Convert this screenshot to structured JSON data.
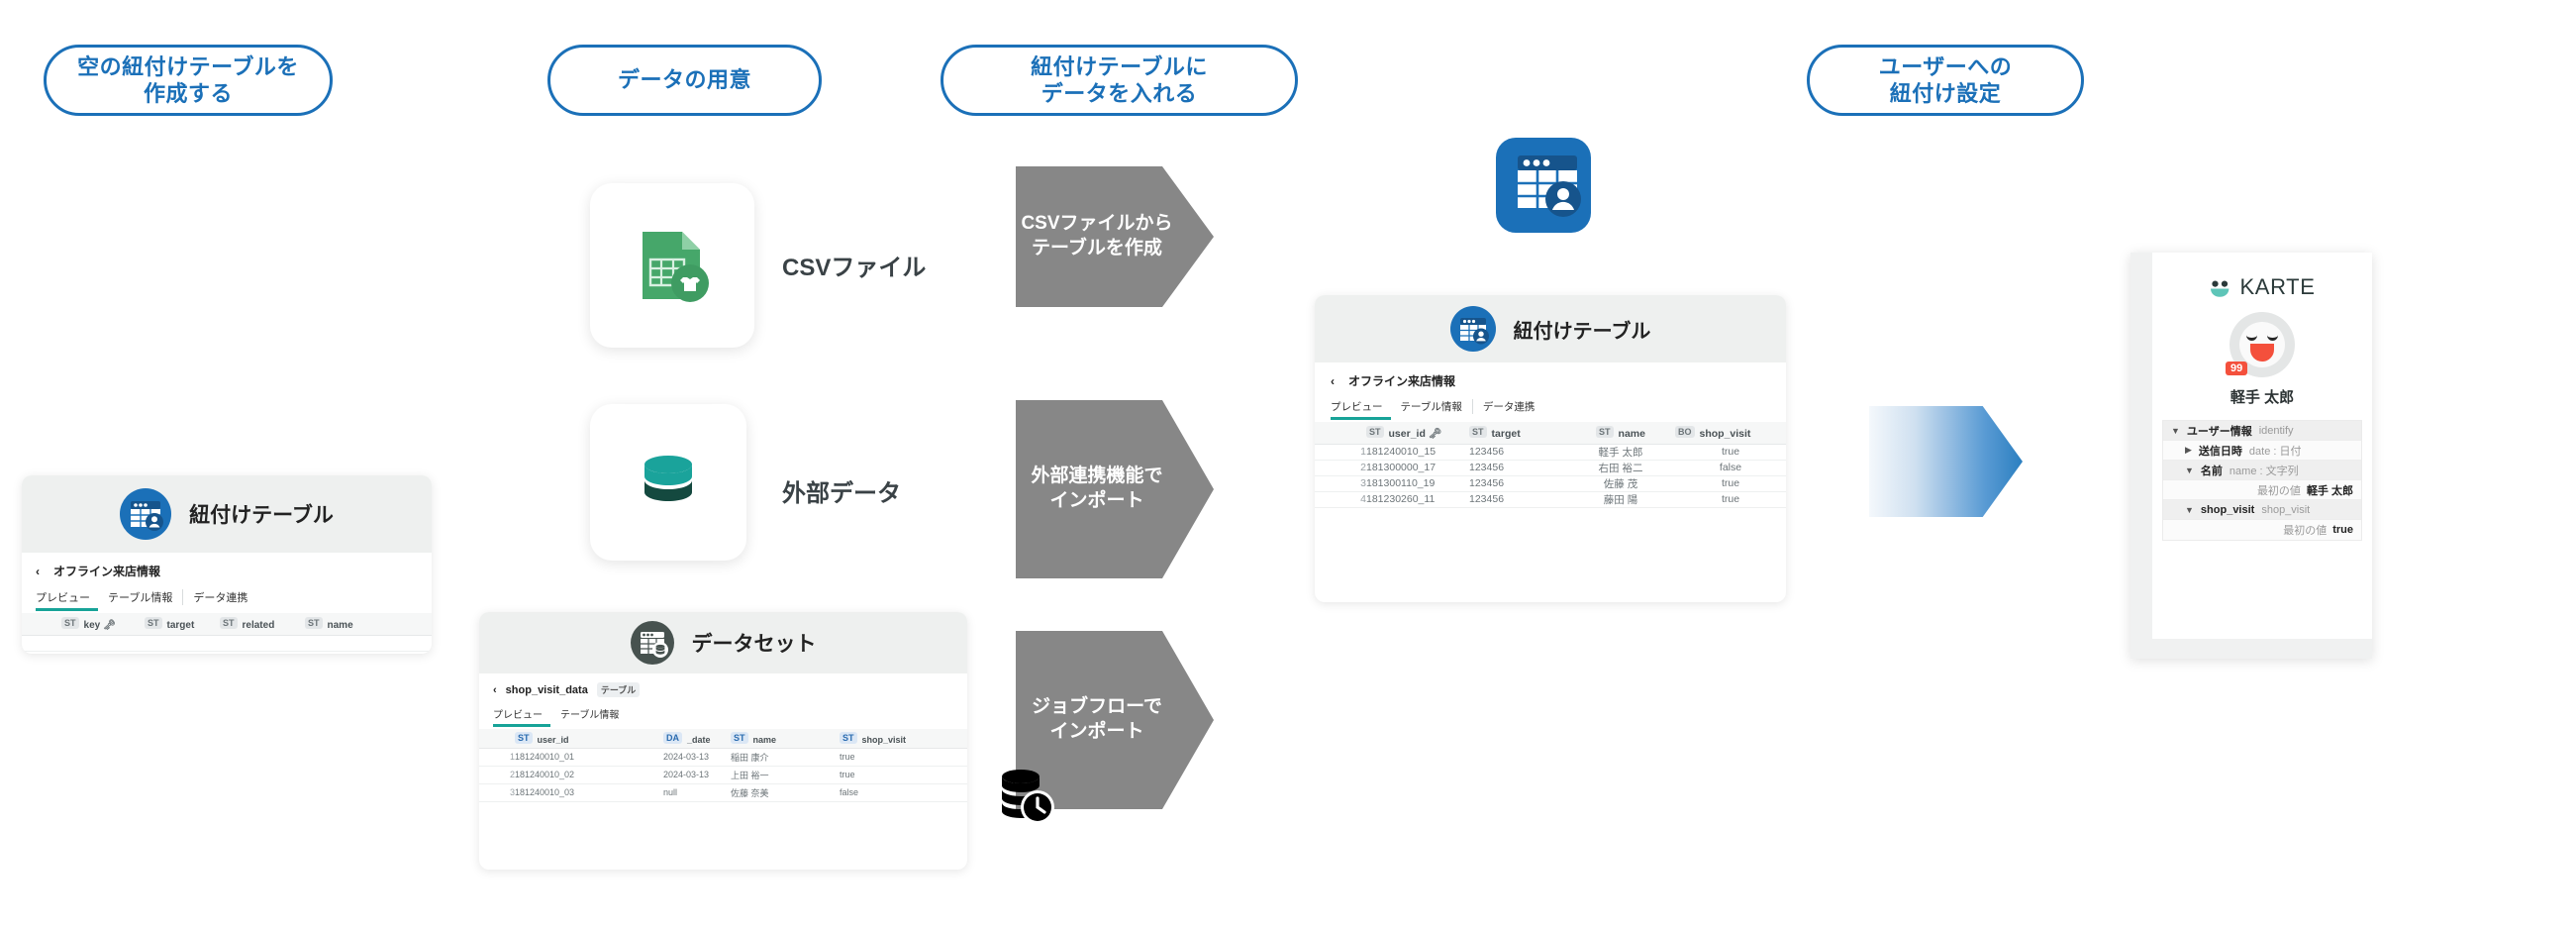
{
  "steps": [
    {
      "id": "step-create-empty-table",
      "label": "空の紐付けテーブルを\n作成する"
    },
    {
      "id": "step-prepare-data",
      "label": "データの用意"
    },
    {
      "id": "step-insert-data",
      "label": "紐付けテーブルに\nデータを入れる"
    },
    {
      "id": "step-user-binding",
      "label": "ユーザーへの\n紐付け設定"
    }
  ],
  "left_card": {
    "header_title": "紐付けテーブル",
    "icon": "linked-table-icon",
    "breadcrumb_chevron": "‹",
    "breadcrumb_label": "オフライン来店情報",
    "tabs": [
      {
        "label": "プレビュー",
        "active": true
      },
      {
        "label": "テーブル情報",
        "active": false
      },
      {
        "label": "データ連携",
        "active": false
      }
    ],
    "columns": [
      {
        "type": "ST",
        "name": "key",
        "key": true
      },
      {
        "type": "ST",
        "name": "target",
        "key": false
      },
      {
        "type": "ST",
        "name": "related",
        "key": false
      },
      {
        "type": "ST",
        "name": "name",
        "key": false
      }
    ],
    "rows": []
  },
  "sources": [
    {
      "id": "csv-file",
      "icon": "csv-file-icon",
      "label": "CSVファイル"
    },
    {
      "id": "external-data",
      "icon": "database-icon",
      "label": "外部データ"
    }
  ],
  "dataset_card": {
    "header_title": "データセット",
    "icon": "dataset-icon",
    "breadcrumb_chevron": "‹",
    "breadcrumb_label": "shop_visit_data",
    "breadcrumb_tag": "テーブル",
    "tabs": [
      {
        "label": "プレビュー",
        "active": true
      },
      {
        "label": "テーブル情報",
        "active": false
      }
    ],
    "columns": [
      {
        "type": "ST",
        "name": "user_id",
        "key": false
      },
      {
        "type": "DA",
        "name": "_date",
        "key": false
      },
      {
        "type": "ST",
        "name": "name",
        "key": false
      },
      {
        "type": "ST",
        "name": "shop_visit",
        "key": false
      }
    ],
    "rows": [
      {
        "n": "1",
        "cells": [
          "181240010_01",
          "2024-03-13",
          "稲田 康介",
          "true"
        ]
      },
      {
        "n": "2",
        "cells": [
          "181240010_02",
          "2024-03-13",
          "上田 裕一",
          "true"
        ]
      },
      {
        "n": "3",
        "cells": [
          "181240010_03",
          "null",
          "佐藤 奈美",
          "false"
        ]
      }
    ]
  },
  "process_arrows": [
    {
      "id": "arrow-create-table-from-csv",
      "label": "CSVファイルから\nテーブルを作成"
    },
    {
      "id": "arrow-import-external-link",
      "label": "外部連携機能で\nインポート"
    },
    {
      "id": "arrow-import-jobflow",
      "label": "ジョブフローで\nインポート"
    }
  ],
  "jobflow_icon": "database-clock-icon",
  "top_icon": "linked-table-icon",
  "main_card": {
    "header_title": "紐付けテーブル",
    "icon": "linked-table-icon",
    "breadcrumb_chevron": "‹",
    "breadcrumb_label": "オフライン来店情報",
    "tabs": [
      {
        "label": "プレビュー",
        "active": true
      },
      {
        "label": "テーブル情報",
        "active": false
      },
      {
        "label": "データ連携",
        "active": false
      }
    ],
    "columns": [
      {
        "type": "ST",
        "name": "user_id",
        "key": true
      },
      {
        "type": "ST",
        "name": "target",
        "key": false
      },
      {
        "type": "ST",
        "name": "name",
        "key": false
      },
      {
        "type": "BO",
        "name": "shop_visit",
        "key": false
      }
    ],
    "rows": [
      {
        "n": "1",
        "cells": [
          "181240010_15",
          "123456",
          "軽手 太郎",
          "true"
        ]
      },
      {
        "n": "2",
        "cells": [
          "181300000_17",
          "123456",
          "右田 裕二",
          "false"
        ]
      },
      {
        "n": "3",
        "cells": [
          "181300110_19",
          "123456",
          "佐藤 茂",
          "true"
        ]
      },
      {
        "n": "4",
        "cells": [
          "181230260_11",
          "123456",
          "藤田 陽",
          "true"
        ]
      }
    ]
  },
  "karte": {
    "logo_text": "KARTE",
    "badge": "99",
    "user_name": "軽手 太郎",
    "tree": [
      {
        "indent": 0,
        "caret": "▼",
        "label": "ユーザー情報",
        "sub": "identify",
        "kind": "section"
      },
      {
        "indent": 1,
        "caret": "▶",
        "label": "送信日時",
        "sub": "date : 日付",
        "kind": "node"
      },
      {
        "indent": 1,
        "caret": "▼",
        "label": "名前",
        "sub": "name : 文字列",
        "kind": "node"
      },
      {
        "indent": 2,
        "caret": "",
        "label": "最初の値",
        "value": "軽手 太郎",
        "kind": "value"
      },
      {
        "indent": 1,
        "caret": "▼",
        "label": "shop_visit",
        "sub": "shop_visit",
        "kind": "node"
      },
      {
        "indent": 2,
        "caret": "",
        "label": "最初の値",
        "value": "true",
        "kind": "value"
      }
    ]
  },
  "colors": {
    "accent_blue": "#1b70b8",
    "teal": "#17a398",
    "gray_arrow": "#878787",
    "csv_green": "#46a76a",
    "db_teal": "#1aa39b",
    "dataset_dark": "#47524f",
    "badge_red": "#f4503c"
  }
}
